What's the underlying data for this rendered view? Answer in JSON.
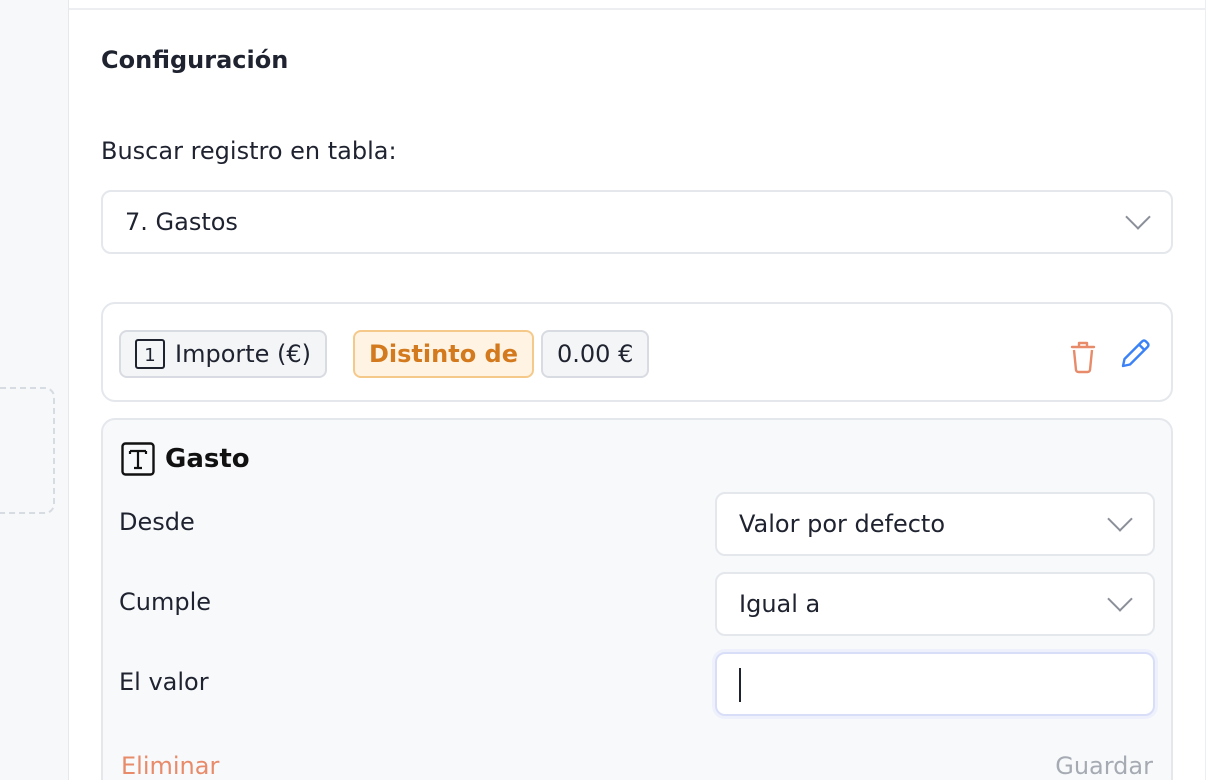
{
  "config": {
    "title": "Configuración",
    "search_label": "Buscar registro en tabla:",
    "table_select_value": "7. Gastos"
  },
  "condition": {
    "field_number": "1",
    "field_label": "Importe (€)",
    "operator": "Distinto de",
    "value": "0.00 €"
  },
  "edit": {
    "field_name": "Gasto",
    "field_type_icon": "T",
    "rows": {
      "desde_label": "Desde",
      "desde_value": "Valor por defecto",
      "cumple_label": "Cumple",
      "cumple_value": "Igual a",
      "valor_label": "El valor",
      "valor_value": ""
    },
    "delete_label": "Eliminar",
    "save_label": "Guardar"
  },
  "colors": {
    "operator_text": "#d37a1e",
    "operator_bg": "#fff4e3",
    "trash": "#e88b6a",
    "pencil": "#3b82f6",
    "delete_text": "#e88b6a",
    "save_text": "#a6abb3"
  },
  "icons": [
    "trash-icon",
    "pencil-icon",
    "chevron-down-icon",
    "text-type-icon",
    "number-type-icon"
  ]
}
